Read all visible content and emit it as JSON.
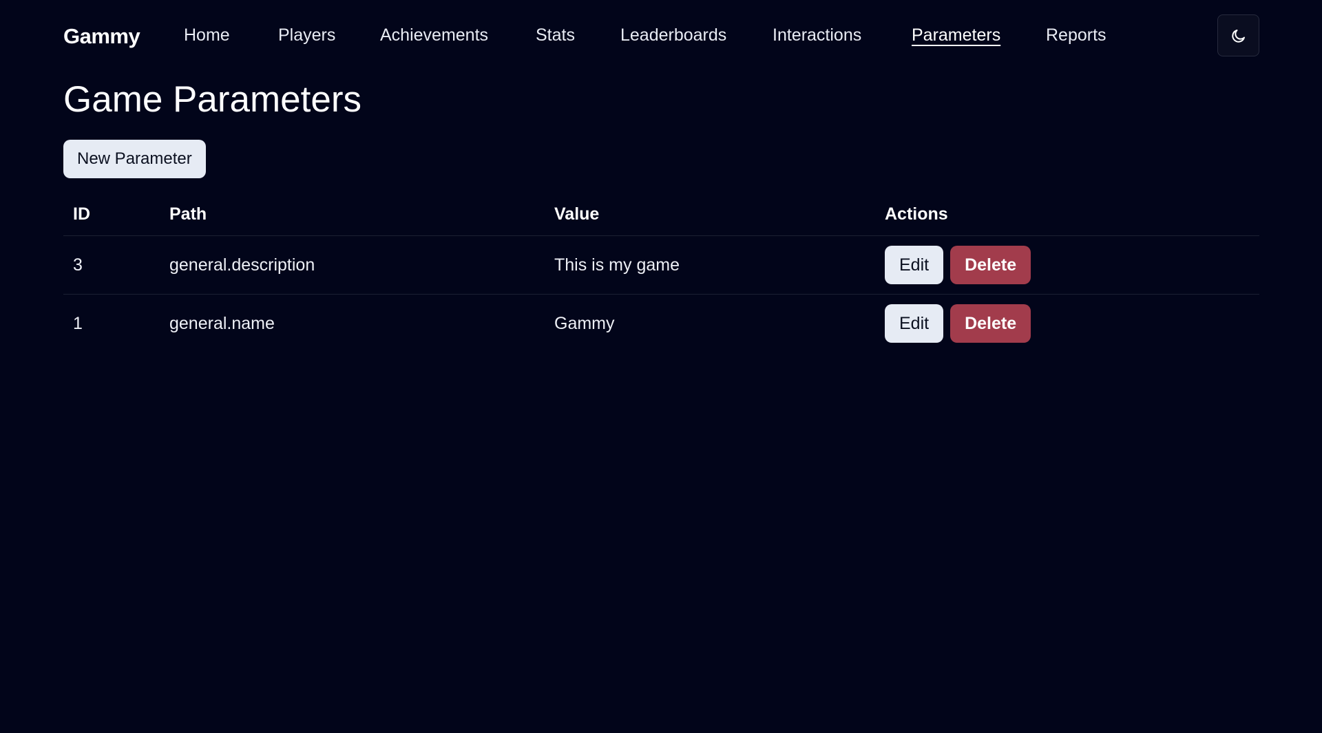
{
  "brand": "Gammy",
  "nav": {
    "items": [
      {
        "label": "Home",
        "active": false
      },
      {
        "label": "Players",
        "active": false
      },
      {
        "label": "Achievements",
        "active": false
      },
      {
        "label": "Stats",
        "active": false
      },
      {
        "label": "Leaderboards",
        "active": false
      },
      {
        "label": "Interactions",
        "active": false
      },
      {
        "label": "Parameters",
        "active": true
      },
      {
        "label": "Reports",
        "active": false
      }
    ],
    "theme_toggle_icon": "moon-icon"
  },
  "page": {
    "title": "Game Parameters",
    "new_button_label": "New Parameter"
  },
  "table": {
    "headers": {
      "id": "ID",
      "path": "Path",
      "value": "Value",
      "actions": "Actions"
    },
    "rows": [
      {
        "id": "3",
        "path": "general.description",
        "value": "This is my game",
        "edit_label": "Edit",
        "delete_label": "Delete"
      },
      {
        "id": "1",
        "path": "general.name",
        "value": "Gammy",
        "edit_label": "Edit",
        "delete_label": "Delete"
      }
    ]
  },
  "colors": {
    "background": "#02051a",
    "button_light": "#e6ebf4",
    "button_danger": "#a23c4c"
  }
}
